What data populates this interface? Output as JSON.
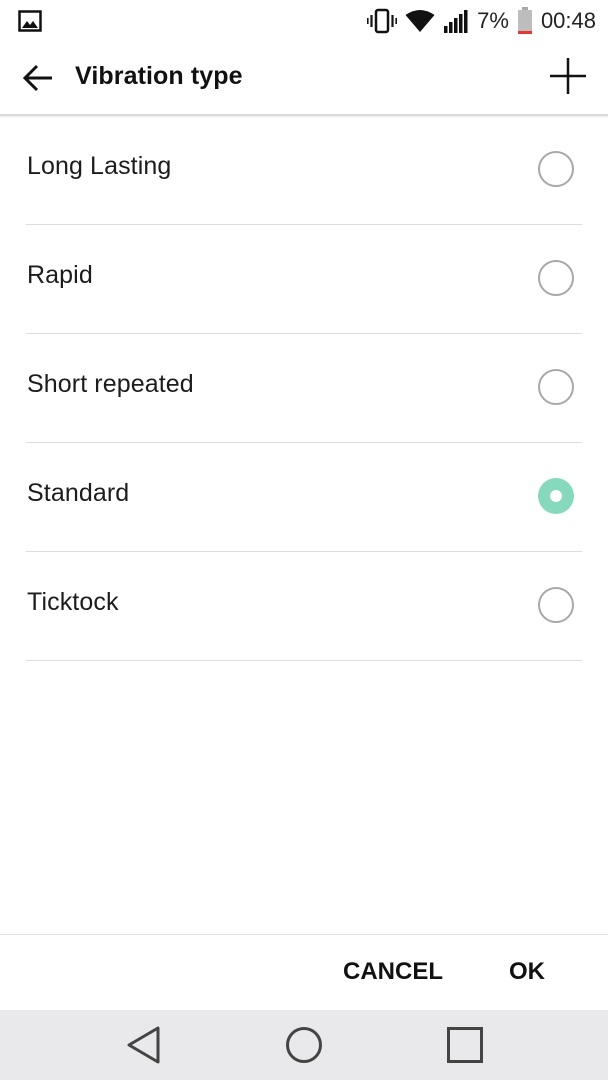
{
  "status_bar": {
    "battery_percent": "7%",
    "time": "00:48",
    "icons": [
      "gallery-icon",
      "vibrate-icon",
      "wifi-icon",
      "signal-icon",
      "battery-icon"
    ],
    "battery_color": "#e53935"
  },
  "app_bar": {
    "title": "Vibration type",
    "back_icon": "arrow-left-icon",
    "add_icon": "plus-icon"
  },
  "options": [
    {
      "label": "Long Lasting",
      "selected": false
    },
    {
      "label": "Rapid",
      "selected": false
    },
    {
      "label": "Short repeated",
      "selected": false
    },
    {
      "label": "Standard",
      "selected": true
    },
    {
      "label": "Ticktock",
      "selected": false
    }
  ],
  "buttons": {
    "cancel": "CANCEL",
    "ok": "OK"
  },
  "nav_bar": {
    "icons": [
      "nav-back-icon",
      "nav-home-icon",
      "nav-recent-icon"
    ]
  },
  "colors": {
    "accent": "#86d9bd",
    "radio_border": "#a8a8a8",
    "nav_background": "#e9e9ec"
  }
}
